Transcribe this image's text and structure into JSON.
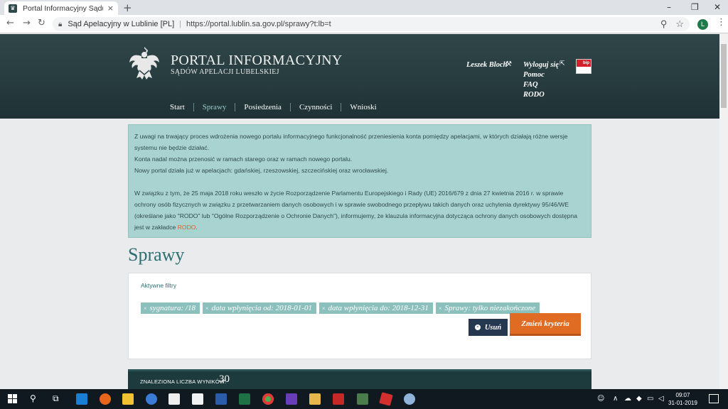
{
  "browser": {
    "tab_title": "Portal Informacyjny Sądu - Sprav",
    "tab_close": "×",
    "new_tab": "+",
    "site_name": "Sąd Apelacyjny w Lublinie [PL]",
    "url": "https://portal.lublin.sa.gov.pl/sprawy?t:lb=t",
    "profile_initial": "L",
    "win_min": "–",
    "win_max": "❐",
    "win_close": "✕"
  },
  "header": {
    "title": "PORTAL INFORMACYJNY",
    "subtitle": "SĄDÓW APELACJI LUBELSKIEJ",
    "user_name": "Leszek Bloch",
    "links": [
      "Wyloguj się",
      "Pomoc",
      "FAQ",
      "RODO"
    ],
    "bip_label": "bip",
    "nav": [
      "Start",
      "Sprawy",
      "Posiedzenia",
      "Czynności",
      "Wnioski"
    ]
  },
  "notice": {
    "p1": "Z uwagi na trwający proces wdrożenia nowego portalu informacyjnego funkcjonalność przeniesienia konta pomiędzy apelacjami, w których działają różne wersje systemu nie będzie działać.",
    "p2": "Konta nadal można przenosić w ramach starego oraz w ramach nowego portalu.",
    "p3": "Nowy portal działa już w apelacjach: gdańskiej, rzeszowskiej, szczecińskiej oraz wrocławskiej.",
    "p4": "W związku z tym, że 25 maja 2018 roku weszło w życie Rozporządzenie Parlamentu Europejskiego i Rady (UE) 2016/679 z dnia 27 kwietnia 2016 r. w sprawie ochrony osób fizycznych w związku z przetwarzaniem danych osobowych i w sprawie swobodnego przepływu takich danych oraz uchylenia dyrektywy 95/46/WE (określane jako \"RODO\" lub \"Ogólne Rozporządzenie o Ochronie Danych\"), informujemy, że klauzula informacyjna dotycząca ochrony danych osobowych dostępna jest w zakładce",
    "p4_link": "RODO",
    "p4_end": "."
  },
  "page": {
    "title": "Sprawy"
  },
  "filters": {
    "label": "Aktywne filtry",
    "chips": [
      "sygnatura: /18",
      "data wpłynięcia od: 2018-01-01",
      "data wpłynięcia do: 2018-12-31",
      "Sprawy: tylko niezakończone"
    ],
    "remove_button": "Usuń",
    "change_button": "Zmień kryteria"
  },
  "results": {
    "label": "ZNALEZIONA LICZBA WYNIKÓW:",
    "count": "30"
  },
  "taskbar": {
    "time": "09:07",
    "date": "31-01-2019"
  },
  "colors": {
    "header_bg": "#263b3e",
    "accent_teal": "#2c6e73",
    "notice_bg": "#a9d3d1",
    "button_orange": "#e06b22",
    "button_navy": "#26384f"
  }
}
